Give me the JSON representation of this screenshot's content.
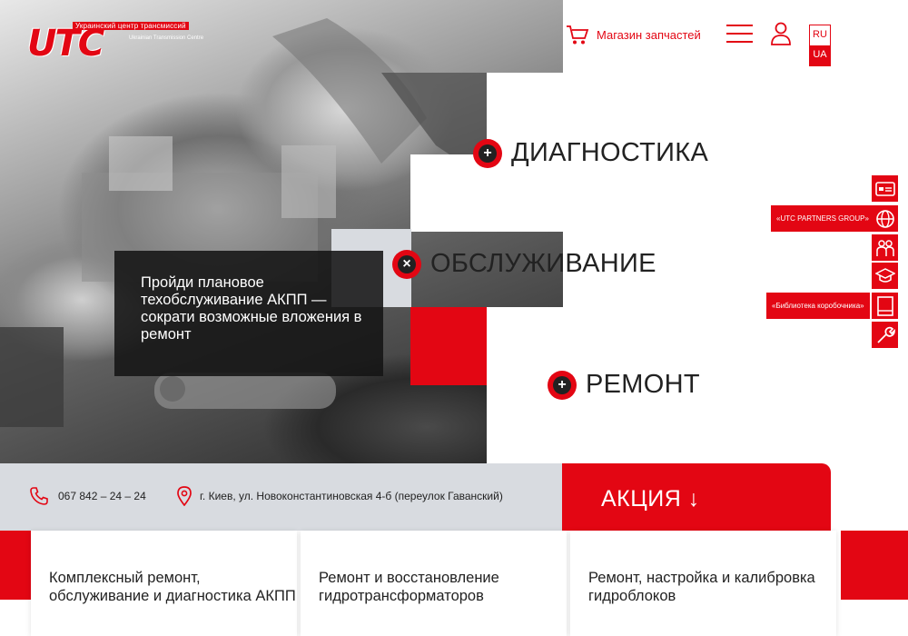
{
  "header": {
    "logo": {
      "brand": "UTC",
      "line1": "Украинский центр трансмиссий",
      "line2": "Ukrainian Transmission Centre"
    },
    "shop_label": "Магазин запчастей",
    "lang": {
      "ru": "RU",
      "ua": "UA"
    }
  },
  "hero": {
    "promo_text": "Пройди плановое техобслуживание АКПП — сократи возможные вложения в ремонт"
  },
  "services": [
    {
      "title": "ДИАГНОСТИКА",
      "icon": "+"
    },
    {
      "title": "ОБСЛУЖИВАНИЕ",
      "icon": "×"
    },
    {
      "title": "РЕМОНТ",
      "icon": "+"
    }
  ],
  "sidebar": {
    "tip_partners": "«UTC PARTNERS GROUP»",
    "tip_library": "«Библиотека коробочника»"
  },
  "contacts": {
    "phone": "067  842 – 24 – 24",
    "address": "г. Киев, ул. Новоконстантиновская 4-б (переулок Гаванский)"
  },
  "promo": {
    "label": "АКЦИЯ ↓"
  },
  "cards": [
    {
      "text": "Комплексный ремонт, обслуживание  и диагностика АКПП"
    },
    {
      "text": "Ремонт и восстановление гидротрансформаторов"
    },
    {
      "text": "Ремонт, настройка и калибровка гидроблоков"
    }
  ],
  "colors": {
    "accent": "#e30613",
    "gray": "#d8dbe0",
    "dark": "#222222"
  }
}
